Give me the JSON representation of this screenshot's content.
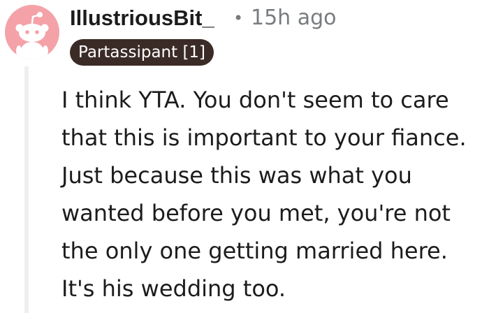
{
  "comment": {
    "author": "IllustriousBit_",
    "separator": "•",
    "timestamp": "15h ago",
    "flair": "Partassipant [1]",
    "body_lines": [
      "I think YTA. You don't seem to care",
      "that this is important to your fiance.",
      "Just because this was what you",
      "wanted before you met, you're not",
      "the only one getting married here.",
      "It's his wedding too."
    ]
  },
  "avatar": {
    "icon": "reddit-snoo-icon",
    "background": "#f4a2a8"
  },
  "colors": {
    "text": "#1c1c1c",
    "meta": "#787c7e",
    "flair_bg": "#3b2b26",
    "flair_text": "#ffffff",
    "thread_line": "#edeff1"
  }
}
